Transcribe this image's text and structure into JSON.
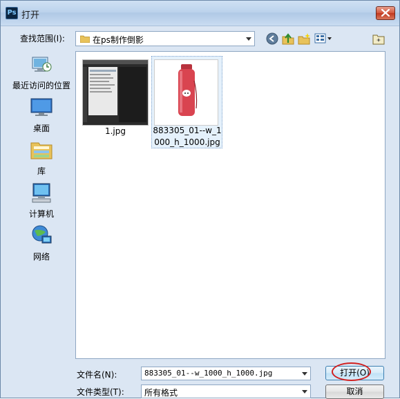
{
  "window": {
    "title": "打开",
    "app_icon_text": "Ps"
  },
  "lookin": {
    "label": "查找范围(I):",
    "value": "在ps制作倒影"
  },
  "toolbar": {
    "icons": [
      "back-icon",
      "up-folder-icon",
      "new-folder-icon",
      "views-menu-icon",
      "preview-icon"
    ]
  },
  "places": [
    {
      "label": "最近访问的位置",
      "icon": "recent-places-icon"
    },
    {
      "label": "桌面",
      "icon": "desktop-icon"
    },
    {
      "label": "库",
      "icon": "libraries-icon"
    },
    {
      "label": "计算机",
      "icon": "computer-icon"
    },
    {
      "label": "网络",
      "icon": "network-icon"
    }
  ],
  "files": [
    {
      "name": "1.jpg",
      "selected": false
    },
    {
      "name": "883305_01--w_1000_h_1000.jpg",
      "selected": true
    }
  ],
  "footer": {
    "filename_label": "文件名(N):",
    "filename_value": "883305_01--w_1000_h_1000.jpg",
    "filetype_label": "文件类型(T):",
    "filetype_value": "所有格式",
    "open_button": "打开(O)",
    "cancel_button": "取消"
  },
  "colors": {
    "highlight_oval": "#d12020",
    "selection": "#e5f1fb",
    "product": "#d94450"
  }
}
